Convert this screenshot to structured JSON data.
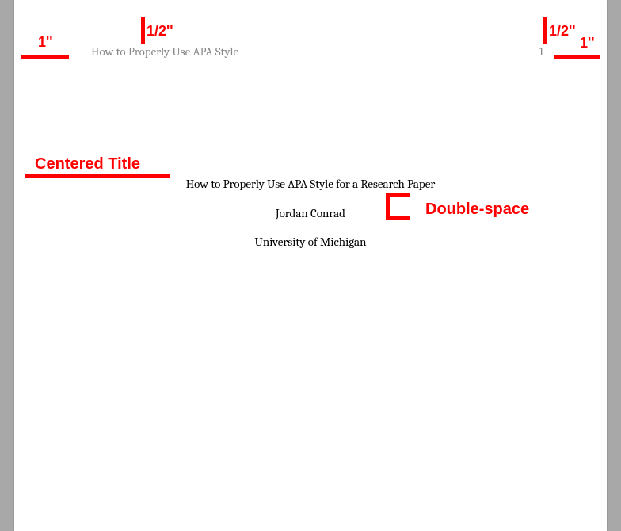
{
  "annotations": {
    "margin_left": "1''",
    "margin_top_left": "1/2''",
    "margin_top_right": "1/2''",
    "margin_right": "1''",
    "centered_title": "Centered Title",
    "double_space": "Double-space"
  },
  "document": {
    "running_head": "How to Properly Use APA Style",
    "page_number": "1",
    "title": "How to Properly Use APA Style for a Research Paper",
    "author": "Jordan Conrad",
    "affiliation": "University of Michigan"
  }
}
